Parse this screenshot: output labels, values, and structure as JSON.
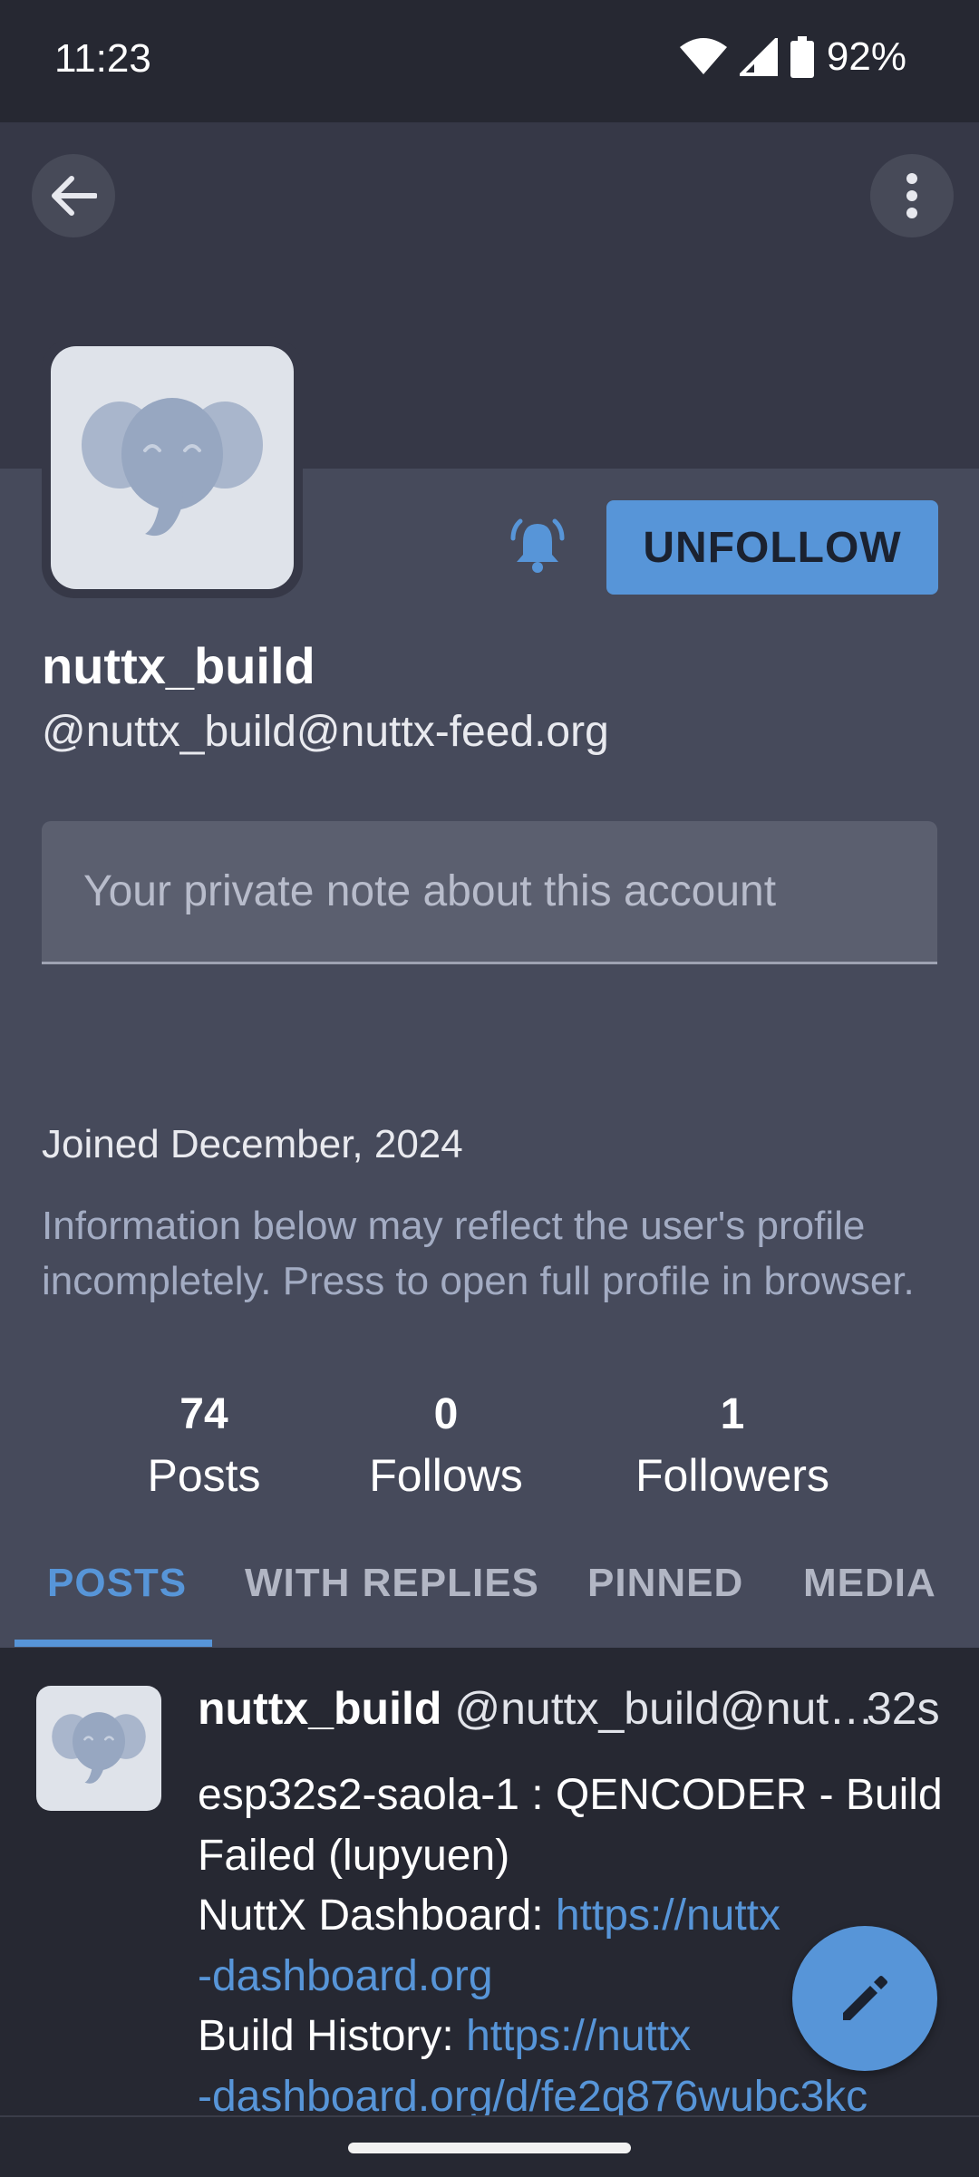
{
  "status_bar": {
    "time": "11:23",
    "battery": "92%"
  },
  "profile": {
    "display_name": "nuttx_build",
    "handle": "@nuttx_build@nuttx-feed.org",
    "follow_button": "UNFOLLOW",
    "note_placeholder": "Your private note about this account",
    "joined": "Joined December, 2024",
    "info": "Information below may reflect the user's profile incompletely. Press to open full profile in browser."
  },
  "stats": [
    {
      "value": "74",
      "label": "Posts"
    },
    {
      "value": "0",
      "label": "Follows"
    },
    {
      "value": "1",
      "label": "Followers"
    }
  ],
  "tabs": [
    {
      "label": "POSTS",
      "active": true
    },
    {
      "label": "WITH REPLIES",
      "active": false
    },
    {
      "label": "PINNED",
      "active": false
    },
    {
      "label": "MEDIA",
      "active": false
    }
  ],
  "post": {
    "author": "nuttx_build",
    "handle": "@nuttx_build@nut…",
    "time": "32s",
    "line1": "esp32s2-saola-1 : QENCODER - Build Failed (lupyuen)",
    "dashboard_label": "NuttX Dashboard: ",
    "dashboard_link_a": "https://nuttx",
    "dashboard_link_b": "-dashboard.org",
    "history_label": "Build History: ",
    "history_link_a": "https://nuttx",
    "history_link_b": "-dashboard.org/d/fe2q876wubc3kc"
  },
  "icons": {
    "back": "arrow-left-icon",
    "menu": "more-vertical-icon",
    "bell": "bell-ringing-icon",
    "compose": "pencil-icon",
    "avatar": "elephant-icon"
  },
  "colors": {
    "accent": "#5795d8",
    "background": "#464a5b",
    "header": "#363847",
    "feed": "#262832"
  }
}
